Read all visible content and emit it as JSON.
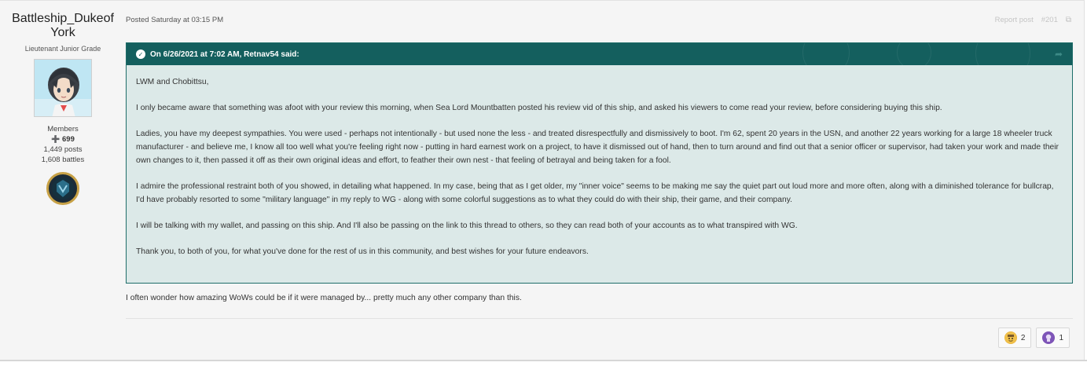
{
  "author": {
    "name": "Battleship_Dukeof York",
    "rank": "Lieutenant Junior Grade",
    "group": "Members",
    "reputation": "699",
    "posts": "1,449 posts",
    "battles": "1,608 battles"
  },
  "post": {
    "date": "Posted Saturday at 03:15 PM",
    "report_label": "Report post",
    "number": "#201"
  },
  "quote": {
    "header": "On 6/26/2021 at 7:02 AM, Retnav54 said:",
    "paragraphs": [
      "LWM and Chobittsu,",
      "I only became aware that something was afoot with your review this morning, when Sea Lord Mountbatten posted his review vid of this ship, and asked his viewers to come read your review, before considering buying this ship.",
      "Ladies, you have my deepest sympathies. You were used - perhaps not intentionally - but used none the less - and treated disrespectfully and dismissively to boot. I'm 62, spent 20 years in the USN, and another 22 years working for a large 18 wheeler truck manufacturer - and believe me, I know all too well what you're feeling right now - putting in hard earnest work on a project, to have it dismissed out of hand, then to turn around and find out that a senior officer or supervisor, had taken your work and made their own changes to it, then passed it off as their own original ideas and effort, to feather their own nest - that feeling of betrayal and being taken for a fool.",
      "I admire the professional restraint both of you showed, in detailing what happened. In my case, being that as I get older, my \"inner voice\" seems to be making me say the quiet part out loud more and more often, along with a diminished tolerance for bullcrap, I'd have probably resorted to some \"military language\" in my reply to WG - along with some colorful suggestions as to what they could do with their ship, their game, and their company.",
      "I will be talking with my wallet, and passing on this ship. And I'll also be passing on the link to this thread to others, so they can read both of your accounts as to what transpired with WG.",
      "Thank you, to both of you, for what you've done for the rest of us in this community, and best wishes for your future endeavors."
    ]
  },
  "comment": "I often wonder how amazing WoWs could be if it were managed by... pretty much any other company than this.",
  "reactions": [
    {
      "icon": "beer-reaction-icon",
      "count": "2"
    },
    {
      "icon": "thanks-reaction-icon",
      "count": "1"
    }
  ],
  "colors": {
    "quote_header": "#145f5e",
    "quote_body": "#dce9e8",
    "reputation_plus": "#3f9d4a"
  }
}
